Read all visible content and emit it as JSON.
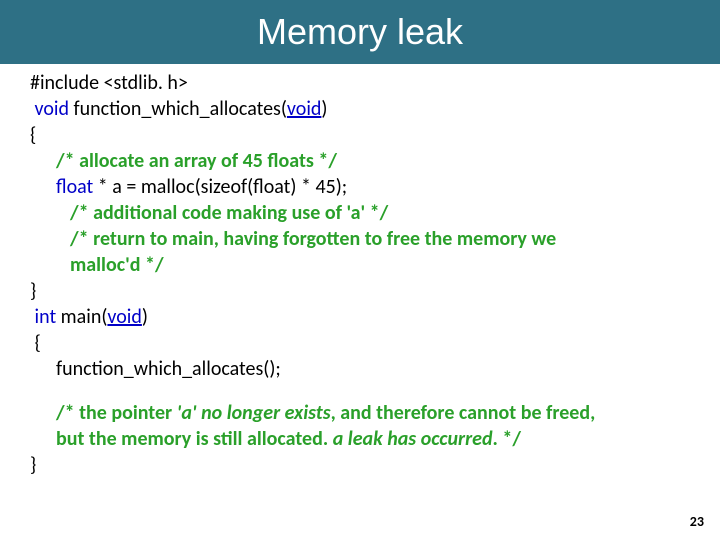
{
  "title": "Memory leak",
  "page_number": "23",
  "code": {
    "l1_pre": "#include <stdlib. h>",
    "l2_kw": "void",
    "l2_fn": " function_which_allocates(",
    "l2_vp": "void",
    "l2_end": ")",
    "l3": "{",
    "l4_com": "/* allocate an array of 45 floats */",
    "l5_kw": "float",
    "l5_rest": " * a = malloc(sizeof(float) * 45);",
    "l6_com": "/* additional code making use of 'a' */",
    "l7_com": "/* return to main, having forgotten to free the memory we",
    "l7b_com": "malloc'd */",
    "l8": "}",
    "l9_kw": "int",
    "l9_fn": " main(",
    "l9_vp": "void",
    "l9_end": ")",
    "l10": " {",
    "l11": "function_which_allocates();",
    "l12a": "/* the pointer ",
    "l12b": "'a' no longer exists",
    "l12c": ", and therefore cannot be freed,",
    "l13a": "but the memory is still allocated. ",
    "l13b": "a leak has occurred",
    "l13c": ". */",
    "l14": "}"
  }
}
